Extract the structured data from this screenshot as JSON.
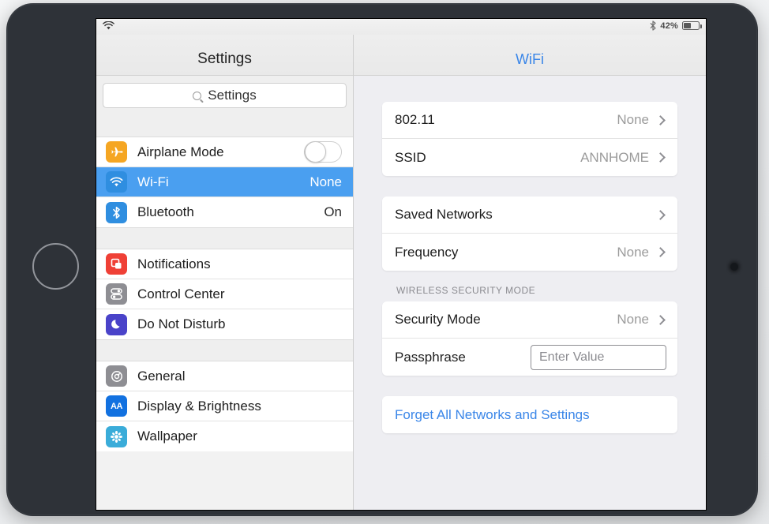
{
  "status_bar": {
    "wifi_icon": "wifi-icon",
    "bluetooth_icon": "bluetooth-icon",
    "battery_percent": "42%",
    "battery_icon": "battery-icon"
  },
  "sidebar": {
    "title": "Settings",
    "search": {
      "icon": "search-icon",
      "value": "Settings",
      "placeholder": "Settings"
    },
    "groups": [
      {
        "items": [
          {
            "label": "Airplane Mode",
            "value": "",
            "icon": "airplane-icon",
            "icon_color": "#f5a623",
            "control": "toggle",
            "toggle_on": false,
            "selected": false
          },
          {
            "label": "Wi-Fi",
            "value": "None",
            "icon": "wifi-icon",
            "icon_color": "#2f8ee0",
            "control": "value",
            "selected": true
          },
          {
            "label": "Bluetooth",
            "value": "On",
            "icon": "bluetooth-icon",
            "icon_color": "#2f8ee0",
            "control": "value",
            "selected": false
          }
        ]
      },
      {
        "items": [
          {
            "label": "Notifications",
            "value": "",
            "icon": "notifications-icon",
            "icon_color": "#ef4036",
            "control": "none",
            "selected": false
          },
          {
            "label": "Control Center",
            "value": "",
            "icon": "control-center-icon",
            "icon_color": "#8e8e93",
            "control": "none",
            "selected": false
          },
          {
            "label": "Do Not Disturb",
            "value": "",
            "icon": "moon-icon",
            "icon_color": "#4a43c9",
            "control": "none",
            "selected": false
          }
        ]
      },
      {
        "items": [
          {
            "label": "General",
            "value": "",
            "icon": "gear-icon",
            "icon_color": "#8e8e93",
            "control": "none",
            "selected": false
          },
          {
            "label": "Display & Brightness",
            "value": "",
            "icon": "display-brightness-icon",
            "icon_color": "#1271e0",
            "control": "none",
            "selected": false
          },
          {
            "label": "Wallpaper",
            "value": "",
            "icon": "wallpaper-icon",
            "icon_color": "#3aacd9",
            "control": "none",
            "selected": false
          }
        ]
      }
    ]
  },
  "detail": {
    "title": "WiFi",
    "cards": [
      {
        "rows": [
          {
            "label": "802.11",
            "value": "None",
            "chevron": true,
            "type": "nav"
          },
          {
            "label": "SSID",
            "value": "ANNHOME",
            "chevron": true,
            "type": "nav"
          }
        ]
      },
      {
        "rows": [
          {
            "label": "Saved Networks",
            "value": "",
            "chevron": true,
            "type": "nav"
          },
          {
            "label": "Frequency",
            "value": "None",
            "chevron": true,
            "type": "nav"
          }
        ]
      }
    ],
    "section_label": "WIRELESS SECURITY MODE",
    "security_card": {
      "rows": [
        {
          "label": "Security Mode",
          "value": "None",
          "chevron": true,
          "type": "nav"
        },
        {
          "label": "Passphrase",
          "value": "",
          "chevron": false,
          "type": "input",
          "input_placeholder": "Enter Value",
          "input_value": ""
        }
      ]
    },
    "action_card": {
      "label": "Forget All Networks and Settings"
    }
  },
  "cursor": {
    "icon": "mouse-pointer-icon"
  },
  "colors": {
    "accent_blue": "#3a86e8",
    "selected_row": "#4a9ff0",
    "device_body": "#2e3238",
    "panel_bg": "#eeeef2"
  }
}
